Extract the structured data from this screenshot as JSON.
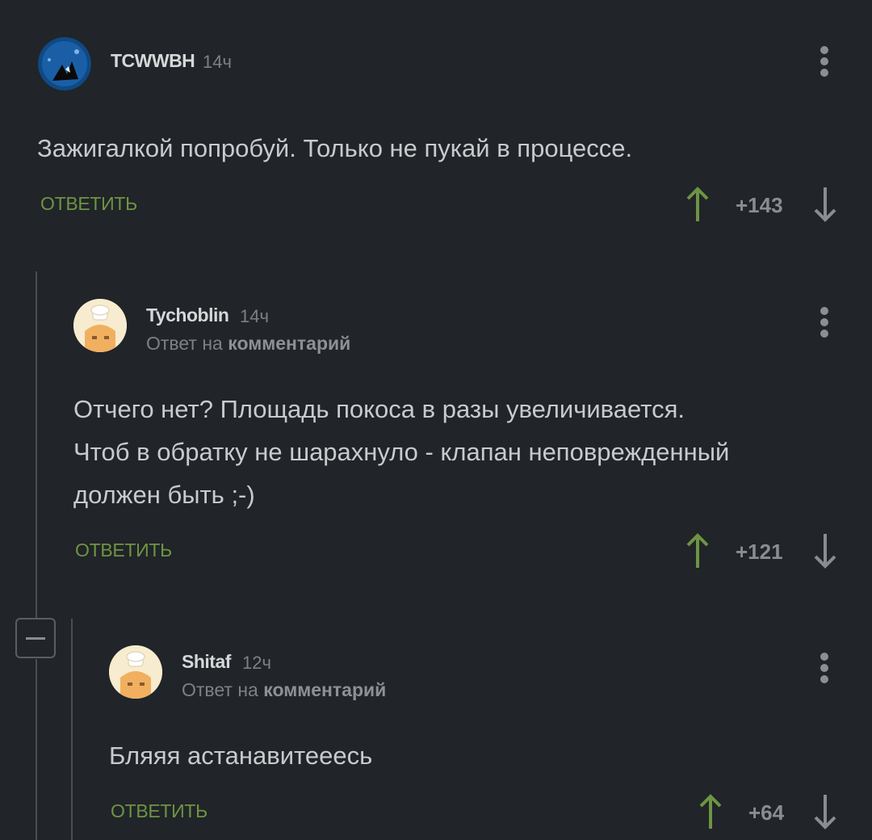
{
  "comments": [
    {
      "username": "TCWWBH",
      "time": "14ч",
      "text": "Зажигалкой попробуй. Только не пукай в процессе.",
      "reply_label": "ОТВЕТИТЬ",
      "score": "+143"
    },
    {
      "username": "Tychoblin",
      "time": "14ч",
      "reply_to_prefix": "Ответ на",
      "reply_to_target": "комментарий",
      "text_lines": [
        "Отчего нет? Площадь покоса в разы увеличивается.",
        "Чтоб в обратку не шарахнуло - клапан неповрежденный",
        "должен быть ;-)"
      ],
      "reply_label": "ОТВЕТИТЬ",
      "score": "+121"
    },
    {
      "username": "Shitaf",
      "time": "12ч",
      "reply_to_prefix": "Ответ на",
      "reply_to_target": "комментарий",
      "text": "Бляяя астанавитееесь",
      "reply_label": "ОТВЕТИТЬ",
      "score": "+64"
    }
  ],
  "colors": {
    "background": "#212428",
    "upvote": "#6d9444",
    "downvote": "#8a8d90",
    "reply": "#6d9444"
  }
}
